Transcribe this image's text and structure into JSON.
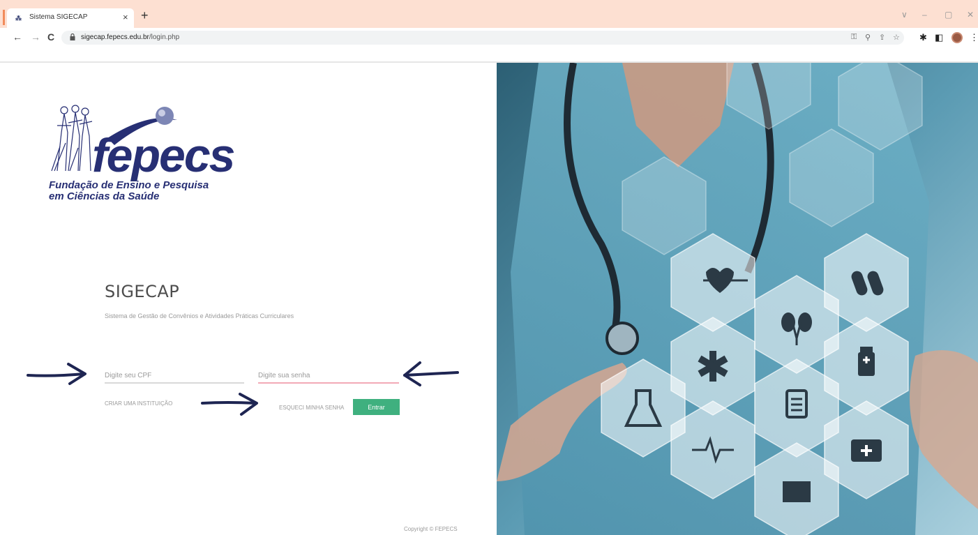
{
  "browser": {
    "tab_title": "Sistema SIGECAP",
    "tab_close": "×",
    "new_tab": "+",
    "url_host": "sigecap.fepecs.edu.br",
    "url_path": "/login.php",
    "back": "←",
    "forward": "→",
    "reload": "C",
    "window_controls": [
      "∨",
      "–",
      "▢",
      "✕"
    ]
  },
  "logo": {
    "wordmark": "fepecs",
    "line1": "Fundação de Ensino e Pesquisa",
    "line2": "em Ciências da Saúde"
  },
  "login": {
    "title": "SIGECAP",
    "subtitle": "Sistema de Gestão de Convênios e Atividades Práticas Curriculares",
    "cpf_placeholder": "Digite seu CPF",
    "password_placeholder": "Digite sua senha",
    "create_institution": "CRIAR UMA INSTITUIÇÃO",
    "forgot_password": "ESQUECI MINHA SENHA",
    "submit": "Entrar",
    "copyright": "Copyright © FEPECS"
  },
  "colors": {
    "brand": "#272f74",
    "button": "#3fb07f",
    "tabbar": "#fde0d2",
    "arrow": "#1e2552"
  }
}
